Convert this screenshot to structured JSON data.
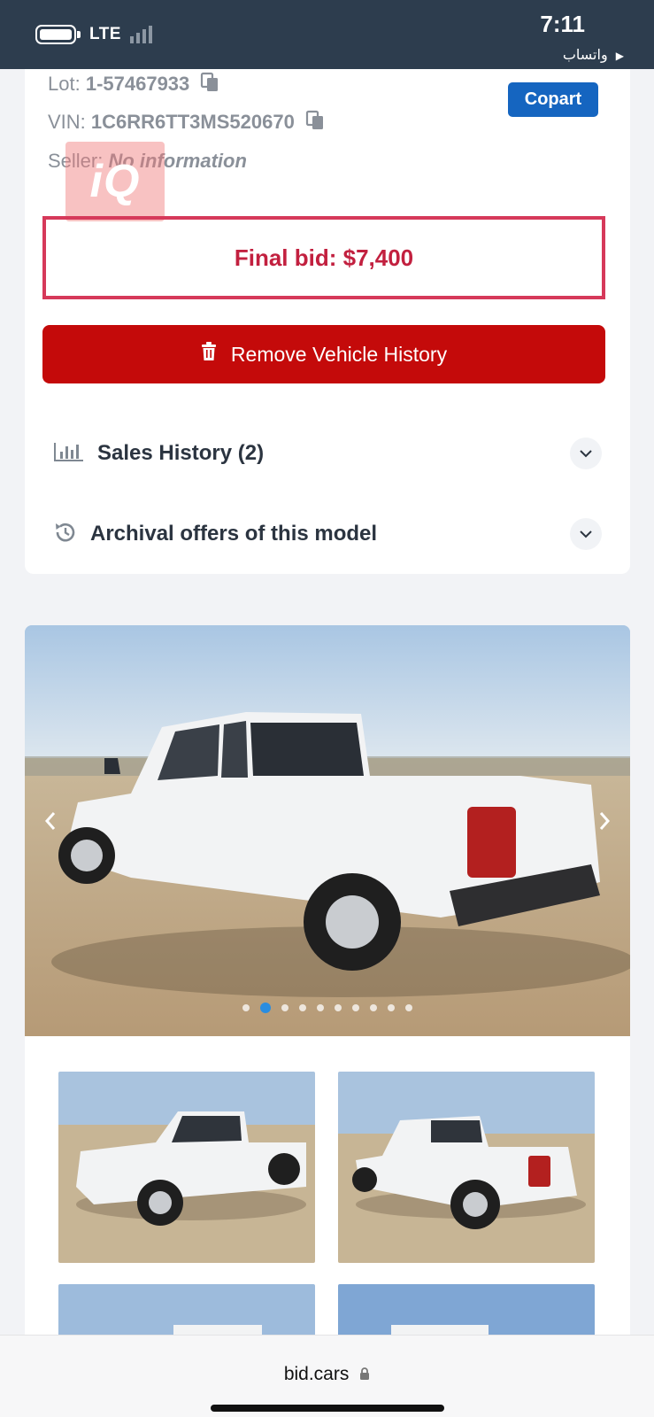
{
  "status_bar": {
    "network": "LTE",
    "time": "7:11",
    "back_app": "واتساب"
  },
  "listing": {
    "lot_label": "Lot:",
    "lot_value": "1-57467933",
    "vin_label": "VIN:",
    "vin_value": "1C6RR6TT3MS520670",
    "seller_label": "Seller:",
    "seller_value": "No information",
    "auction_badge": "Copart",
    "watermark_logo": "iQ",
    "final_bid": "Final bid: $7,400",
    "remove_button_label": "Remove Vehicle History"
  },
  "accordions": [
    {
      "icon": "bar-chart-icon",
      "label": "Sales History (2)"
    },
    {
      "icon": "history-icon",
      "label": "Archival offers of this model"
    }
  ],
  "gallery": {
    "photo_count": 10,
    "active_index": 1
  },
  "colors": {
    "status_bar": "#2d3d4e",
    "final_bid_border": "#d6395a",
    "final_bid_text": "#c2203f",
    "remove_button": "#c40a0a",
    "copart_badge": "#1565c0",
    "active_dot": "#2a8de0"
  },
  "browser": {
    "url": "bid.cars"
  }
}
